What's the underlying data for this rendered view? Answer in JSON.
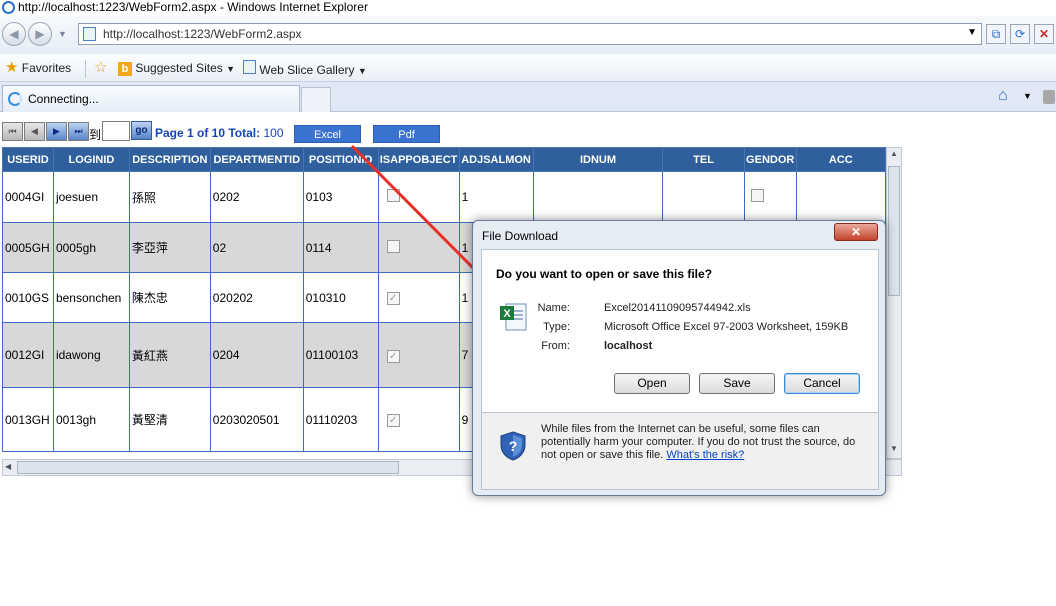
{
  "browser": {
    "window_title": "http://localhost:1223/WebForm2.aspx - Windows Internet Explorer",
    "address": "http://localhost:1223/WebForm2.aspx",
    "favorites_label": "Favorites",
    "suggested_sites": "Suggested Sites",
    "web_slice_gallery": "Web Slice Gallery",
    "tab_label": "Connecting..."
  },
  "pager": {
    "to_label": "到",
    "go_label": "go",
    "page_text": "Page 1 of 10 Total:",
    "total": "100",
    "excel_label": "Excel",
    "pdf_label": "Pdf"
  },
  "grid": {
    "columns": [
      "USERID",
      "LOGINID",
      "DESCRIPTION",
      "DEPARTMENTID",
      "POSITIONID",
      "ISAPPOBJECT",
      "ADJSALMON",
      "IDNUM",
      "TEL",
      "GENDOR",
      "ACC"
    ],
    "rows": [
      {
        "userid": "0004GI",
        "loginid": "joesuen",
        "description": "孫照",
        "departmentid": "0202",
        "positionid": "0103",
        "isappobject": "",
        "adjsalmon": "1",
        "gendor": ""
      },
      {
        "userid": "0005GH",
        "loginid": "0005gh",
        "description": "李亞萍",
        "departmentid": "02",
        "positionid": "0114",
        "isappobject": "",
        "adjsalmon": "1",
        "gendor": ""
      },
      {
        "userid": "0010GS",
        "loginid": "bensonchen",
        "description": "陳杰忠",
        "departmentid": "020202",
        "positionid": "010310",
        "isappobject": "✓",
        "adjsalmon": "1",
        "gendor": ""
      },
      {
        "userid": "0012GI",
        "loginid": "idawong",
        "description": "黃紅燕",
        "departmentid": "0204",
        "positionid": "01100103",
        "isappobject": "✓",
        "adjsalmon": "7",
        "gendor": ""
      },
      {
        "userid": "0013GH",
        "loginid": "0013gh",
        "description": "黃堅清",
        "departmentid": "0203020501",
        "positionid": "01110203",
        "isappobject": "✓",
        "adjsalmon": "9",
        "gendor": ""
      }
    ]
  },
  "dialog": {
    "title": "File Download",
    "close_label": "✕",
    "question": "Do you want to open or save this file?",
    "name_label": "Name:",
    "name_value": "Excel20141109095744942.xls",
    "type_label": "Type:",
    "type_value": "Microsoft Office Excel 97-2003 Worksheet, 159KB",
    "from_label": "From:",
    "from_value": "localhost",
    "open_label": "Open",
    "save_label": "Save",
    "cancel_label": "Cancel",
    "warning_text": "While files from the Internet can be useful, some files can potentially harm your computer. If you do not trust the source, do not open or save this file.",
    "risk_link": "What's the risk?"
  },
  "colors": {
    "header_bg": "#2f5f9c",
    "excel_btn": "#3a72cf",
    "pager_text": "#1744b8",
    "annotation_arrow": "#e8302b"
  }
}
